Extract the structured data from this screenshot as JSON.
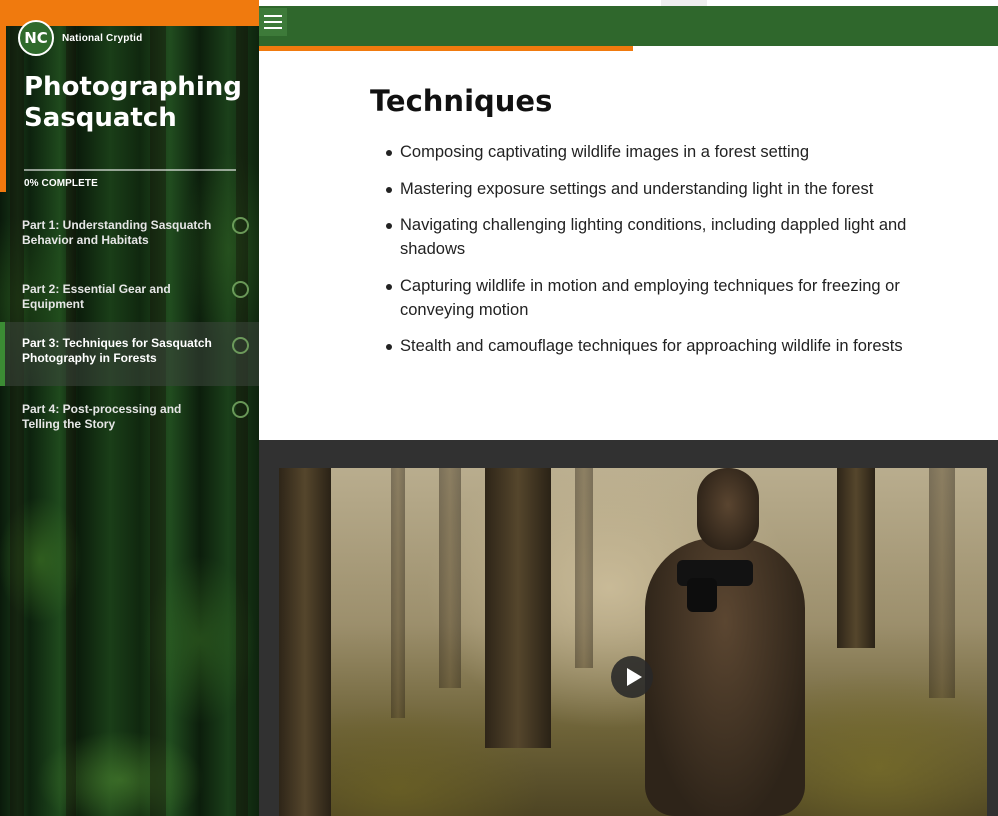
{
  "brand": {
    "logo_text": "NC",
    "name": "National Cryptid"
  },
  "course": {
    "title": "Photographing Sasquatch",
    "progress_label": "0% COMPLETE",
    "progress_fraction": 0
  },
  "nav": {
    "items": [
      {
        "label": "Part 1: Understanding Sasquatch Behavior and Habitats",
        "active": false,
        "complete": false
      },
      {
        "label": "Part 2: Essential Gear and Equipment",
        "active": false,
        "complete": false
      },
      {
        "label": "Part 3: Techniques for Sasquatch Photography in Forests",
        "active": true,
        "complete": false
      },
      {
        "label": "Part 4: Post-processing and Telling the Story",
        "active": false,
        "complete": false
      }
    ]
  },
  "header": {
    "menu_icon": "hamburger-icon"
  },
  "content": {
    "title": "Techniques",
    "bullets": [
      "Composing captivating wildlife images in a forest setting",
      "Mastering exposure settings and understanding light in the forest",
      "Navigating challenging lighting conditions, including dappled light and shadows",
      "Capturing wildlife in motion and employing techniques for freezing or conveying motion",
      "Stealth and camouflage techniques for approaching wildlife in forests"
    ]
  },
  "media": {
    "play_icon": "play-icon"
  },
  "colors": {
    "accent_orange": "#f07a0e",
    "header_green": "#2f672c",
    "active_marker": "#3b8c34",
    "media_band": "#313131"
  }
}
